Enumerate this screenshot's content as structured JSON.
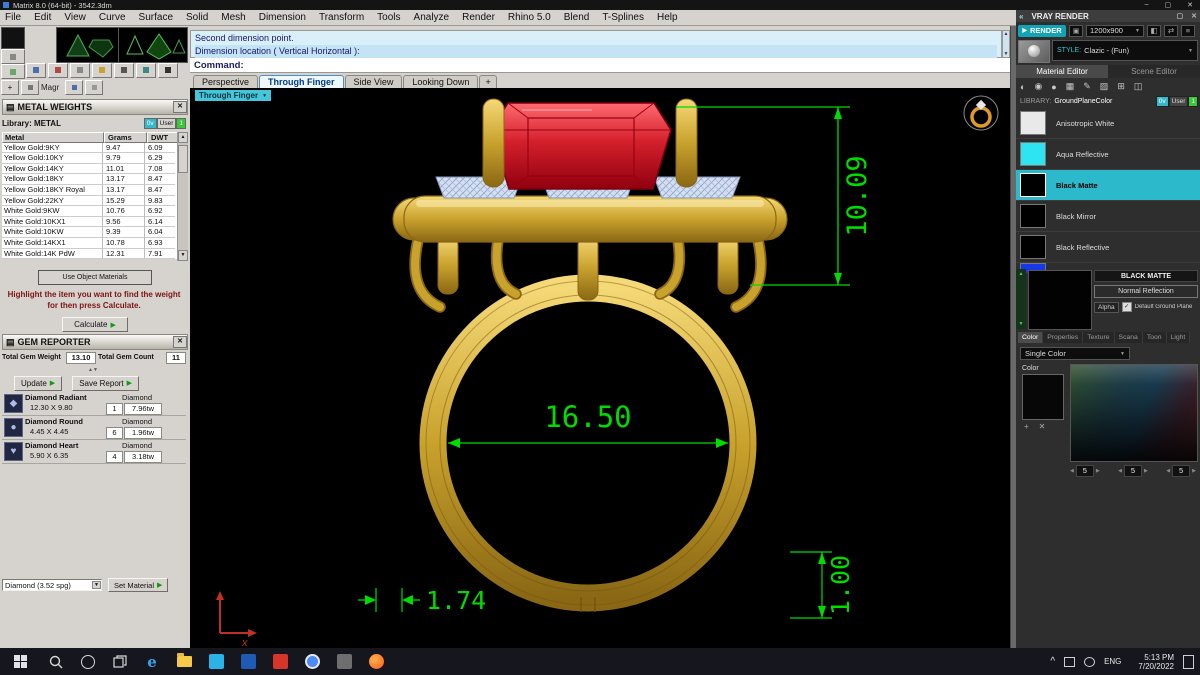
{
  "window": {
    "title": "Matrix 8.0 (64-bit) - 3542.3dm",
    "menus": [
      "File",
      "Edit",
      "View",
      "Curve",
      "Surface",
      "Solid",
      "Mesh",
      "Dimension",
      "Transform",
      "Tools",
      "Analyze",
      "Render",
      "Rhino 5.0",
      "Blend",
      "T-Splines",
      "Help"
    ]
  },
  "left_toolbar": {
    "label": "Magr"
  },
  "metal_weights": {
    "title": "METAL WEIGHTS",
    "library_label": "Library: METAL",
    "toggles": [
      "0v",
      "User",
      "1"
    ],
    "columns": [
      "Metal",
      "Grams",
      "DWT"
    ],
    "rows": [
      [
        "Yellow Gold:9KY",
        "9.47",
        "6.09"
      ],
      [
        "Yellow Gold:10KY",
        "9.79",
        "6.29"
      ],
      [
        "Yellow Gold:14KY",
        "11.01",
        "7.08"
      ],
      [
        "Yellow Gold:18KY",
        "13.17",
        "8.47"
      ],
      [
        "Yellow Gold:18KY Royal",
        "13.17",
        "8.47"
      ],
      [
        "Yellow Gold:22KY",
        "15.29",
        "9.83"
      ],
      [
        "White Gold:9KW",
        "10.76",
        "6.92"
      ],
      [
        "White Gold:10KX1",
        "9.56",
        "6.14"
      ],
      [
        "White Gold:10KW",
        "9.39",
        "6.04"
      ],
      [
        "White Gold:14KX1",
        "10.78",
        "6.93"
      ],
      [
        "White Gold:14K PdW",
        "12.31",
        "7.91"
      ]
    ],
    "use_object_materials": "Use Object Materials",
    "hint_line1": "Highlight the item you want to find the weight",
    "hint_line2": "for then press Calculate.",
    "calculate_label": "Calculate"
  },
  "gem_reporter": {
    "title": "GEM REPORTER",
    "total_weight_label": "Total Gem Weight",
    "total_weight": "13.10",
    "total_count_label": "Total Gem Count",
    "total_count": "11",
    "update_label": "Update",
    "save_label": "Save Report",
    "gems": [
      {
        "name": "Diamond Radiant",
        "size": "12.30 X 9.80",
        "count": "1",
        "weight": "7.96tw",
        "material": "Diamond"
      },
      {
        "name": "Diamond Round",
        "size": "4.45 X 4.45",
        "count": "6",
        "weight": "1.96tw",
        "material": "Diamond"
      },
      {
        "name": "Diamond Heart",
        "size": "5.90 X 6.35",
        "count": "4",
        "weight": "3.18tw",
        "material": "Diamond"
      }
    ],
    "material_select": "Diamond  (3.52 spg)",
    "set_material_label": "Set Material"
  },
  "command": {
    "history_line1": "Second dimension point.",
    "history_line2": "Dimension location ( Vertical  Horizontal ):",
    "prompt": "Command:"
  },
  "viewport": {
    "tabs": [
      "Perspective",
      "Through Finger",
      "Side View",
      "Looking Down"
    ],
    "active_tab": "Through Finger",
    "view_label": "Through Finger",
    "dimensions": {
      "head_height": "10.09",
      "inner_diameter": "16.50",
      "shank_width": "1.74",
      "shank_thickness": "1.00"
    }
  },
  "vray": {
    "title": "VRAY RENDER",
    "render_label": "RENDER",
    "resolution": "1200x900",
    "style_label": "STYLE:",
    "style_value": "Clazic - (Fun)",
    "tabs": [
      "Material Editor",
      "Scene Editor"
    ],
    "library_label": "LIBRARY:",
    "library_value": "GroundPlaneColor",
    "toggles": [
      "0v",
      "User",
      "1"
    ],
    "materials": [
      "Anisotropic White",
      "Aqua Reflective",
      "Black Matte",
      "Black Mirror",
      "Black Reflective"
    ],
    "preview_title": "BLACK MATTE",
    "normal_reflection": "Normal Reflection",
    "alpha_label": "Alpha",
    "ground_plane_label": "Default Ground Plane",
    "prop_tabs": [
      "Color",
      "Properties",
      "Texture",
      "Scana",
      "Toon",
      "Light"
    ],
    "single_color": "Single Color",
    "color_label": "Color",
    "rgb": [
      "5",
      "5",
      "5"
    ]
  },
  "taskbar": {
    "lang": "ENG",
    "time": "5:13 PM",
    "date": "7/20/2022"
  },
  "icons": {
    "close": "✕",
    "minimize": "–",
    "maximize": "▢",
    "dropdown": "▼",
    "up": "▲",
    "down": "▼",
    "left": "◀",
    "right": "▶",
    "play": "▶",
    "chevrons": "«",
    "plus": "+",
    "check": "✓",
    "panel_icon": "▤",
    "camera": "▣",
    "edge_glyph": "e",
    "tray_chevron": "^",
    "gem_radiant": "◆",
    "gem_round": "●",
    "gem_heart": "♥",
    "x_axis_label": "x",
    "vray_tools": [
      "◐",
      "◉",
      "●",
      "▦",
      "✎",
      "▨",
      "⊞",
      "◫"
    ]
  }
}
